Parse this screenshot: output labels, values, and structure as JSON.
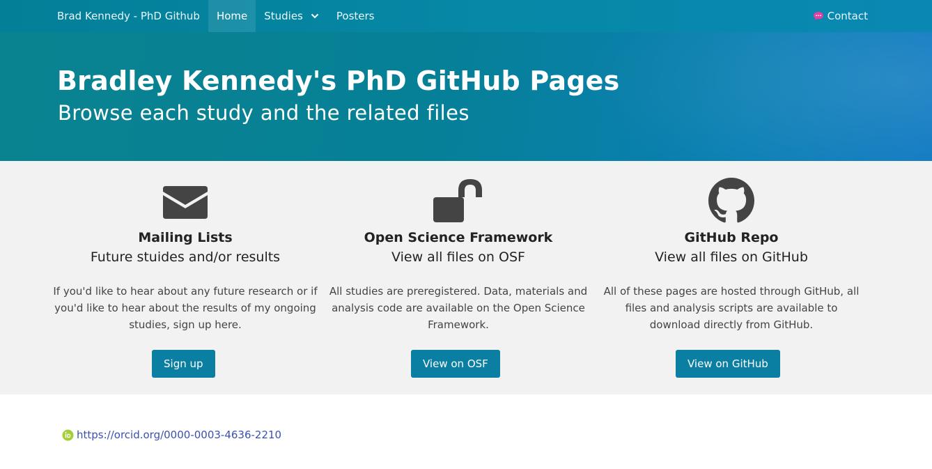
{
  "nav": {
    "brand": "Brad Kennedy - PhD Github",
    "home": "Home",
    "studies": "Studies",
    "posters": "Posters",
    "contact": "Contact"
  },
  "hero": {
    "title": "Bradley Kennedy's PhD GitHub Pages",
    "subtitle": "Browse each study and the related files"
  },
  "cards": [
    {
      "icon": "envelope-icon",
      "title": "Mailing Lists",
      "subtitle": "Future stuides and/or results",
      "text": "If you'd like to hear about any future research or if you'd like to hear about the results of my ongoing studies, sign up here.",
      "button": "Sign up"
    },
    {
      "icon": "unlock-icon",
      "title": "Open Science Framework",
      "subtitle": "View all files on OSF",
      "text": "All studies are preregistered. Data, materials and analysis code are available on the Open Science Framework.",
      "button": "View on OSF"
    },
    {
      "icon": "github-icon",
      "title": "GitHub Repo",
      "subtitle": "View all files on GitHub",
      "text": "All of these pages are hosted through GitHub, all files and analysis scripts are available to download directly from GitHub.",
      "button": "View on GitHub"
    }
  ],
  "footer": {
    "orcid_url": "https://orcid.org/0000-0003-4636-2210",
    "orcid_icon": "orcid-icon"
  },
  "colors": {
    "nav_bg": "#0689a8",
    "hero_start": "#0a8390",
    "hero_end": "#0c78c1",
    "button_bg": "#0a7fa2",
    "feature_bg": "#f2f2f2",
    "contact_icon": "#e040a0",
    "orcid_green": "#a6ce39",
    "link": "#3b4fb5"
  }
}
